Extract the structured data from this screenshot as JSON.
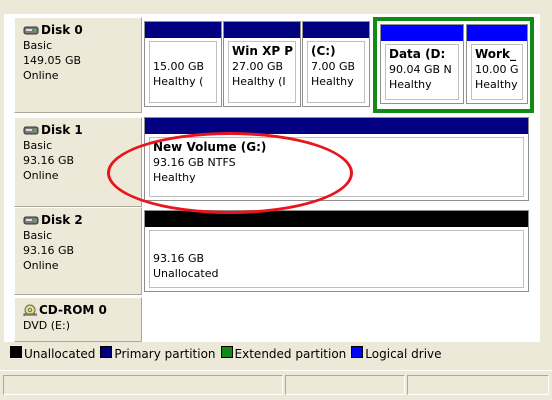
{
  "disks": [
    {
      "name": "Disk 0",
      "type": "Basic",
      "size": "149.05 GB",
      "status": "Online",
      "partitions": [
        {
          "name": "",
          "size": "15.00 GB",
          "status": "Healthy ("
        },
        {
          "name": "Win XP P",
          "size": "27.00 GB",
          "status": "Healthy (I"
        },
        {
          "name": "(C:)",
          "size": "7.00 GB",
          "status": "Healthy"
        },
        {
          "name": "Data (D:",
          "size": "90.04 GB N",
          "status": "Healthy"
        },
        {
          "name": "Work_",
          "size": "10.00 G",
          "status": "Healthy"
        }
      ]
    },
    {
      "name": "Disk 1",
      "type": "Basic",
      "size": "93.16 GB",
      "status": "Online",
      "partitions": [
        {
          "name": "New Volume  (G:)",
          "size": "93.16 GB NTFS",
          "status": "Healthy"
        }
      ]
    },
    {
      "name": "Disk 2",
      "type": "Basic",
      "size": "93.16 GB",
      "status": "Online",
      "partitions": [
        {
          "name": "",
          "size": "93.16 GB",
          "status": "Unallocated"
        }
      ]
    },
    {
      "name": "CD-ROM 0",
      "type": "DVD (E:)"
    }
  ],
  "legend": [
    {
      "label": "Unallocated",
      "color": "#000000"
    },
    {
      "label": "Primary partition",
      "color": "#000080"
    },
    {
      "label": "Extended partition",
      "color": "#138a13"
    },
    {
      "label": "Logical drive",
      "color": "#0000ff"
    }
  ],
  "colors": {
    "primary": "#000080",
    "logical": "#0000ff",
    "unallocated": "#000000",
    "extended": "#138a13",
    "annotation_circle": "#e8151c"
  }
}
